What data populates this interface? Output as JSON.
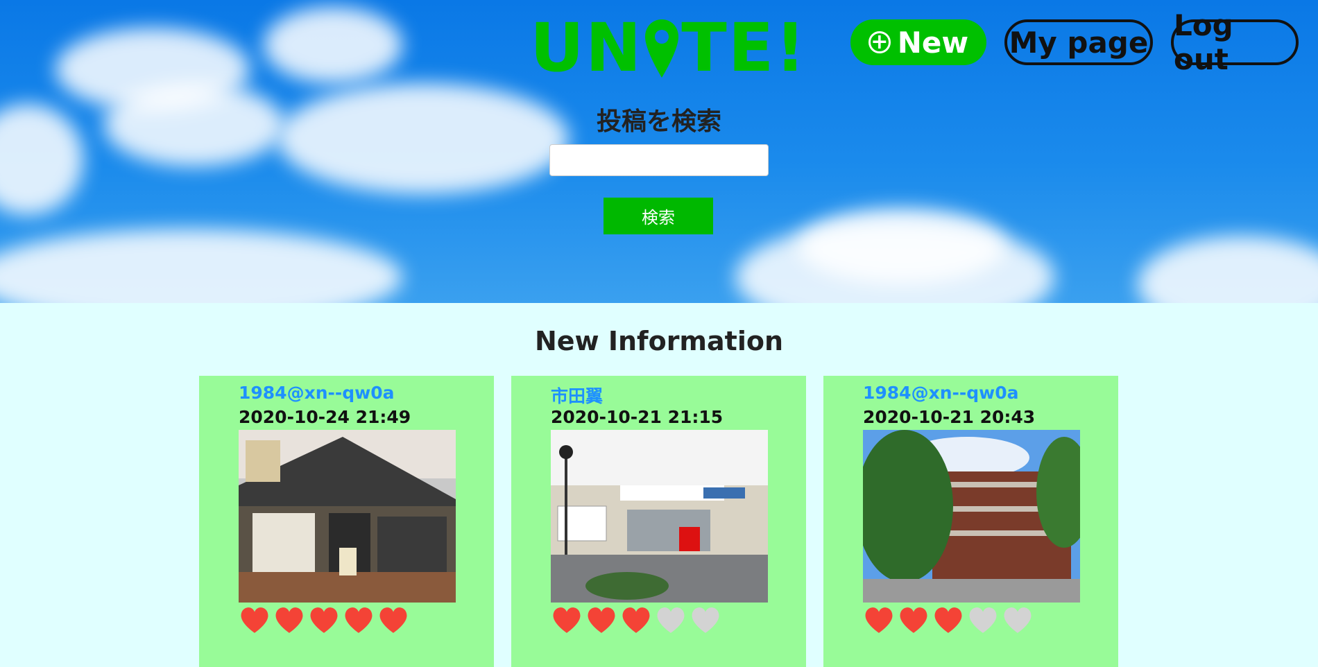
{
  "header": {
    "logo_text": "UNITE!",
    "new_button": {
      "icon": "plus-circle-icon",
      "label": "New"
    },
    "mypage_button": "My page",
    "logout_button": "Log out"
  },
  "search": {
    "title": "投稿を検索",
    "placeholder": "",
    "value": "",
    "button": "検索"
  },
  "section_title": "New Information",
  "posts": [
    {
      "user": "1984@xn--qw0a",
      "datetime": "2020-10-24 21:49",
      "image": "restaurant-exterior",
      "rating": 5
    },
    {
      "user": "市田翼",
      "datetime": "2020-10-21 21:15",
      "image": "train-station",
      "rating": 3
    },
    {
      "user": "1984@xn--qw0a",
      "datetime": "2020-10-21 20:43",
      "image": "school-building",
      "rating": 3
    }
  ],
  "colors": {
    "accent": "#00c000",
    "heart_on": "#f44336",
    "heart_off": "#d3d3d3",
    "card_bg": "#98fb98",
    "user_link": "#1e90ff"
  }
}
